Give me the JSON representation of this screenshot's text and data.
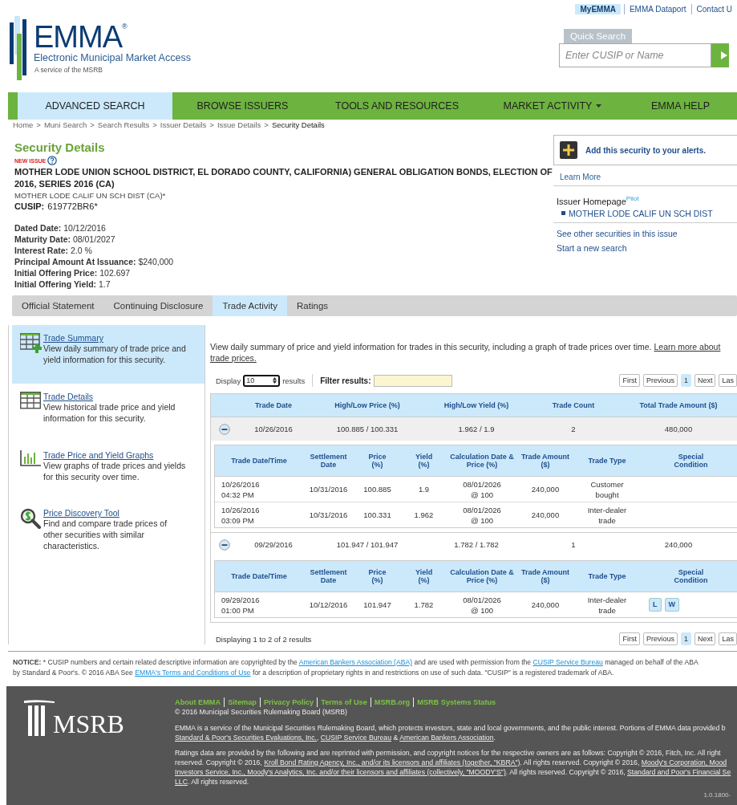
{
  "top_links": [
    {
      "label": "MyEMMA",
      "selected": true
    },
    {
      "label": "EMMA Dataport",
      "selected": false
    },
    {
      "label": "Contact U",
      "selected": false
    }
  ],
  "logo": {
    "name": "EMMA",
    "mark": "®",
    "tagline": "Electronic Municipal Market Access",
    "subline": "A service of the MSRB"
  },
  "quick_search": {
    "tab": "Quick Search",
    "placeholder": "Enter CUSIP or Name"
  },
  "nav": [
    {
      "label": "ADVANCED SEARCH",
      "selected": true,
      "has_menu": false
    },
    {
      "label": "BROWSE ISSUERS",
      "selected": false,
      "has_menu": false
    },
    {
      "label": "TOOLS AND RESOURCES",
      "selected": false,
      "has_menu": false
    },
    {
      "label": "MARKET ACTIVITY",
      "selected": false,
      "has_menu": true
    },
    {
      "label": "EMMA HELP",
      "selected": false,
      "has_menu": false
    }
  ],
  "breadcrumb": [
    {
      "label": "Home",
      "separator": ">",
      "current": false
    },
    {
      "label": "Muni Search",
      "separator": ">",
      "current": false
    },
    {
      "label": "Search Results",
      "separator": ">",
      "current": false
    },
    {
      "label": "Issuer Details",
      "separator": ">",
      "current": false
    },
    {
      "label": "Issue Details",
      "separator": ">",
      "current": false
    },
    {
      "label": "Security Details",
      "current": true
    }
  ],
  "security": {
    "heading": "Security Details",
    "badge": "NEW ISSUE",
    "title": "MOTHER LODE UNION SCHOOL DISTRICT, EL DORADO COUNTY, CALIFORNIA) GENERAL OBLIGATION BONDS, ELECTION OF 2016, SERIES 2016 (CA)",
    "short_name": "MOTHER LODE CALIF UN SCH DIST (CA)*",
    "cusip_label": "CUSIP:",
    "cusip": "619772BR6*",
    "details": [
      {
        "label": "Dated Date:",
        "value": "10/12/2016"
      },
      {
        "label": "Maturity Date:",
        "value": "08/01/2027"
      },
      {
        "label": "Interest Rate:",
        "value": "2.0 %"
      },
      {
        "label": "Principal Amount At Issuance:",
        "value": "$240,000"
      },
      {
        "label": "Initial Offering Price:",
        "value": "102.697"
      },
      {
        "label": "Initial Offering Yield:",
        "value": "1.7"
      }
    ]
  },
  "side_panel": {
    "alert": "Add this security to your alerts.",
    "learn_more": "Learn More",
    "issuer_label": "Issuer Homepage",
    "issuer_tag": "Pilot",
    "issuer": "MOTHER LODE CALIF UN SCH DIST",
    "links": [
      "See other securities in this issue",
      "Start a new search"
    ]
  },
  "tabs": [
    {
      "label": "Official Statement",
      "selected": false
    },
    {
      "label": "Continuing Disclosure",
      "selected": false
    },
    {
      "label": "Trade Activity",
      "selected": true
    },
    {
      "label": "Ratings",
      "selected": false
    }
  ],
  "menu": [
    {
      "kind": "summary",
      "title": "Trade Summary",
      "text": "View daily summary of trade price and yield information for this security.",
      "selected": true
    },
    {
      "kind": "details",
      "title": "Trade Details",
      "text": "View historical trade price and yield information for this security.",
      "selected": false
    },
    {
      "kind": "graphs",
      "title": "Trade Price and Yield Graphs",
      "text": "View graphs of trade prices and yields for this security over time.",
      "selected": false
    },
    {
      "kind": "discovery",
      "title": "Price Discovery Tool",
      "text": "Find and compare trade prices of other securities with similar characteristics.",
      "selected": false
    }
  ],
  "intro": {
    "text": "View daily summary of price and yield information for trades in this security, including a graph of trade prices over time.",
    "link_1": "Learn more about",
    "link_2": "trade prices."
  },
  "controls": {
    "display": "Display",
    "page_size": "10",
    "results": "results",
    "filter_label": "Filter results:"
  },
  "pagination_top": [
    {
      "label": "First",
      "selected": false
    },
    {
      "label": "Previous",
      "selected": false
    },
    {
      "label": "1",
      "selected": true
    },
    {
      "label": "Next",
      "selected": false
    },
    {
      "label": "Las",
      "selected": false
    }
  ],
  "summary_columns": [
    "Trade Date",
    "High/Low Price (%)",
    "High/Low Yield (%)",
    "Trade Count",
    "Total Trade Amount ($)"
  ],
  "groups": [
    {
      "expanded": true,
      "date": "10/26/2016",
      "price": "100.885 / 100.331",
      "yield": "1.962 / 1.9",
      "count": "2",
      "amount": "480,000",
      "columns": [
        "Trade Date/Time",
        "Settlement Date",
        "Price (%)",
        "Yield (%)",
        "Calculation Date & Price (%)",
        "Trade Amount ($)",
        "Trade Type",
        "Special Condition"
      ],
      "trades": [
        {
          "time": "10/26/2016 04:32 PM",
          "settlement": "10/31/2016",
          "price": "100.885",
          "yield": "1.9",
          "calc": "08/01/2026 @ 100",
          "amount": "240,000",
          "type": "Customer bought"
        },
        {
          "time": "10/26/2016 03:09 PM",
          "settlement": "10/31/2016",
          "price": "100.331",
          "yield": "1.962",
          "calc": "08/01/2026 @ 100",
          "amount": "240,000",
          "type": "Inter-dealer trade"
        }
      ]
    },
    {
      "expanded": true,
      "date": "09/29/2016",
      "price": "101.947 / 101.947",
      "yield": "1.782 / 1.782",
      "count": "1",
      "amount": "240,000",
      "columns": [
        "Trade Date/Time",
        "Settlement Date",
        "Price (%)",
        "Yield (%)",
        "Calculation Date & Price (%)",
        "Trade Amount ($)",
        "Trade Type",
        "Special Condition"
      ],
      "trades": [
        {
          "time": "09/29/2016 01:00 PM",
          "settlement": "10/12/2016",
          "price": "101.947",
          "yield": "1.782",
          "calc": "08/01/2026 @ 100",
          "amount": "240,000",
          "type": "Inter-dealer trade",
          "conditions": [
            "L",
            "W"
          ]
        }
      ]
    }
  ],
  "result_count": "Displaying 1 to 2 of 2 results",
  "pagination_bottom": [
    {
      "label": "First",
      "selected": false
    },
    {
      "label": "Previous",
      "selected": false
    },
    {
      "label": "1",
      "selected": true
    },
    {
      "label": "Next",
      "selected": false
    },
    {
      "label": "Las",
      "selected": false
    }
  ],
  "notice": [
    [
      {
        "kind": "bold",
        "text": "NOTICE:"
      },
      {
        "kind": "text",
        "text": " * CUSIP numbers and certain related descriptive information are copyrighted by the "
      },
      {
        "kind": "link",
        "text": "American Bankers Association (ABA)"
      },
      {
        "kind": "text",
        "text": " and are used with permission from the "
      },
      {
        "kind": "link",
        "text": "CUSIP Service Bureau"
      },
      {
        "kind": "text",
        "text": " managed on behalf of the ABA"
      }
    ],
    [
      {
        "kind": "text",
        "text": "by Standard & Poor's. © 2016 ABA See "
      },
      {
        "kind": "link",
        "text": "EMMA's Terms and Conditions of Use"
      },
      {
        "kind": "text",
        "text": " for a description of proprietary rights in and restrictions on use of such data. \"CUSIP\" is a registered trademark of ABA."
      }
    ]
  ],
  "footer": {
    "logo": "MSRB",
    "links": [
      "About EMMA",
      "Sitemap",
      "Privacy Policy",
      "Terms of Use",
      "MSRB.org",
      "MSRB Systems Status"
    ],
    "copyright": "© 2016 Municipal Securities Rulemaking Board (MSRB)",
    "paragraphs": [
      [
        [
          {
            "kind": "text",
            "text": "EMMA is a service of the Municipal Securities Rulemaking Board, which protects investors, state and local governments, and the public interest. Portions of EMMA data provided b"
          }
        ],
        [
          {
            "kind": "link",
            "text": "Standard & Poor's Securities Evaluations, Inc."
          },
          {
            "kind": "text",
            "text": ", "
          },
          {
            "kind": "link",
            "text": "CUSIP Service Bureau"
          },
          {
            "kind": "text",
            "text": " & "
          },
          {
            "kind": "link",
            "text": "American Bankers Association"
          },
          {
            "kind": "text",
            "text": "."
          }
        ]
      ],
      [
        [
          {
            "kind": "text",
            "text": "Ratings data are provided by the following and are reprinted with permission, and copyright notices for the respective owners are as follows: Copyright © 2016, Fitch, Inc. All right"
          }
        ],
        [
          {
            "kind": "text",
            "text": "reserved. Copyright © 2016, "
          },
          {
            "kind": "link",
            "text": "Kroll Bond Rating Agency, Inc., and/or its licensors and affiliates (together, \"KBRA\")"
          },
          {
            "kind": "text",
            "text": ". All rights reserved. Copyright © 2016, "
          },
          {
            "kind": "link",
            "text": "Moody's Corporation, Mood"
          }
        ],
        [
          {
            "kind": "link",
            "text": "Investors Service, Inc., Moody's Analytics, Inc. and/or their licensors and affiliates (collectively, \"MOODY'S\")"
          },
          {
            "kind": "text",
            "text": ". All rights reserved. Copyright © 2016, "
          },
          {
            "kind": "link",
            "text": "Standard and Poor's Financial Se"
          }
        ],
        [
          {
            "kind": "link",
            "text": "LLC"
          },
          {
            "kind": "text",
            "text": ". All rights reserved."
          }
        ]
      ]
    ],
    "version": "1.0.1800-"
  }
}
